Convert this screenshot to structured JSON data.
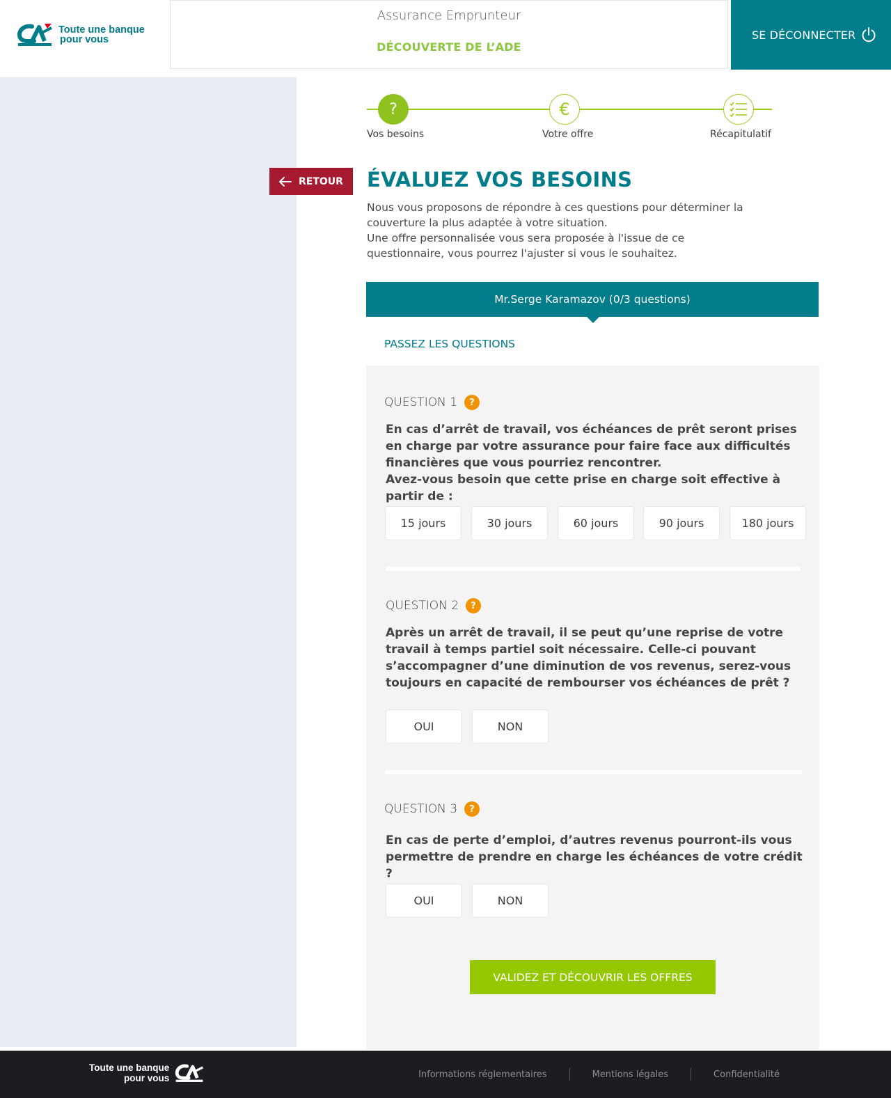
{
  "brand": {
    "logo_line1": "Toute une banque",
    "logo_line2": "pour vous",
    "primary_color": "#007c8a",
    "accent_color": "#8dc21f",
    "alert_color": "#a6192e",
    "help_color": "#f39200"
  },
  "header": {
    "title": "Assurance Emprunteur",
    "subtitle": "DÉCOUVERTE DE L’ADE",
    "logout_label": "SE DÉCONNECTER",
    "logout_icon": "power-icon"
  },
  "stepper": {
    "steps": [
      {
        "label": "Vos besoins",
        "icon": "question-mark-icon",
        "glyph": "?",
        "active": true
      },
      {
        "label": "Votre offre",
        "icon": "euro-icon",
        "glyph": "€",
        "active": false
      },
      {
        "label": "Récapitulatif",
        "icon": "checklist-icon",
        "active": false
      }
    ]
  },
  "back_button": {
    "label": "RETOUR",
    "icon": "arrow-left-icon"
  },
  "main": {
    "title": "ÉVALUEZ VOS BESOINS",
    "intro_line1": "Nous vous proposons de répondre à ces questions pour déterminer la couverture la plus adaptée à votre situation.",
    "intro_line2": "Une offre personnalisée vous sera proposée à l'issue de ce questionnaire, vous pourrez l'ajuster si vous le souhaitez.",
    "person_bar": "Mr.Serge Karamazov (0/3 questions)",
    "skip_link": "PASSEZ LES QUESTIONS"
  },
  "questions": [
    {
      "header": "QUESTION 1",
      "text_line1": "En cas d’arrêt de travail, vos échéances de prêt seront prises en charge par votre assurance pour faire face aux difficultés financières que vous pourriez rencontrer.",
      "text_line2": "Avez-vous besoin que cette prise en charge soit effective à partir de :",
      "options": [
        "15 jours",
        "30 jours",
        "60 jours",
        "90 jours",
        "180 jours"
      ]
    },
    {
      "header": "QUESTION 2",
      "text_line1": "Après un arrêt de travail, il se peut qu’une reprise de votre travail à temps partiel soit nécessaire. Celle-ci pouvant s’accompagner d’une diminution de vos revenus, serez-vous toujours en capacité de rembourser vos échéances de prêt ?",
      "options": [
        "OUI",
        "NON"
      ]
    },
    {
      "header": "QUESTION 3",
      "text_line1": "En cas de perte d’emploi, d’autres revenus pourront-ils vous permettre de prendre en charge les échéances de votre crédit ?",
      "options": [
        "OUI",
        "NON"
      ]
    }
  ],
  "help_glyph": "?",
  "validate_label": "VALIDEZ ET DÉCOUVRIR LES OFFRES",
  "footer": {
    "logo_line1": "Toute une banque",
    "logo_line2": "pour vous",
    "links": [
      "Informations réglementaires",
      "Mentions légales",
      "Confidentialité"
    ]
  }
}
